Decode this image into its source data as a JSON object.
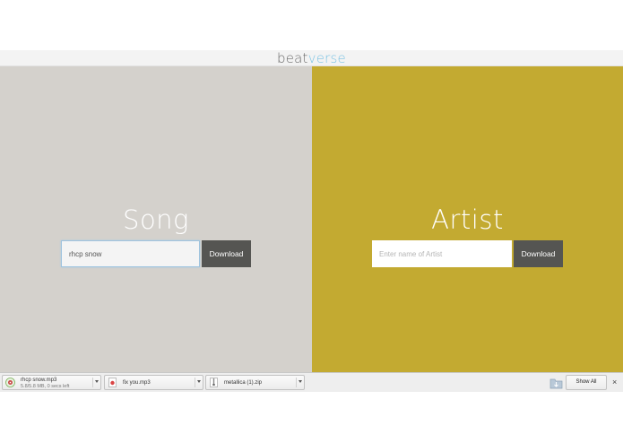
{
  "header": {
    "logo_part1": "beat",
    "logo_part2": "verse"
  },
  "song_panel": {
    "title": "Song",
    "input_value": "rhcp snow",
    "button_label": "Download"
  },
  "artist_panel": {
    "title": "Artist",
    "input_placeholder": "Enter name of Artist",
    "button_label": "Download"
  },
  "colors": {
    "song_bg": "#d4d1cc",
    "artist_bg": "#c3aa31",
    "button_bg": "#555552",
    "logo_accent": "#7ec4e4"
  },
  "downloads_bar": {
    "items": [
      {
        "name": "rhcp snow.mp3",
        "status": "5.8/5.8 MB, 0 secs left",
        "icon": "audio-file-icon"
      },
      {
        "name": "fix you.mp3",
        "icon": "audio-file-icon"
      },
      {
        "name": "metallica (1).zip",
        "icon": "zip-file-icon"
      }
    ],
    "show_all_label": "Show All",
    "close_glyph": "×"
  }
}
